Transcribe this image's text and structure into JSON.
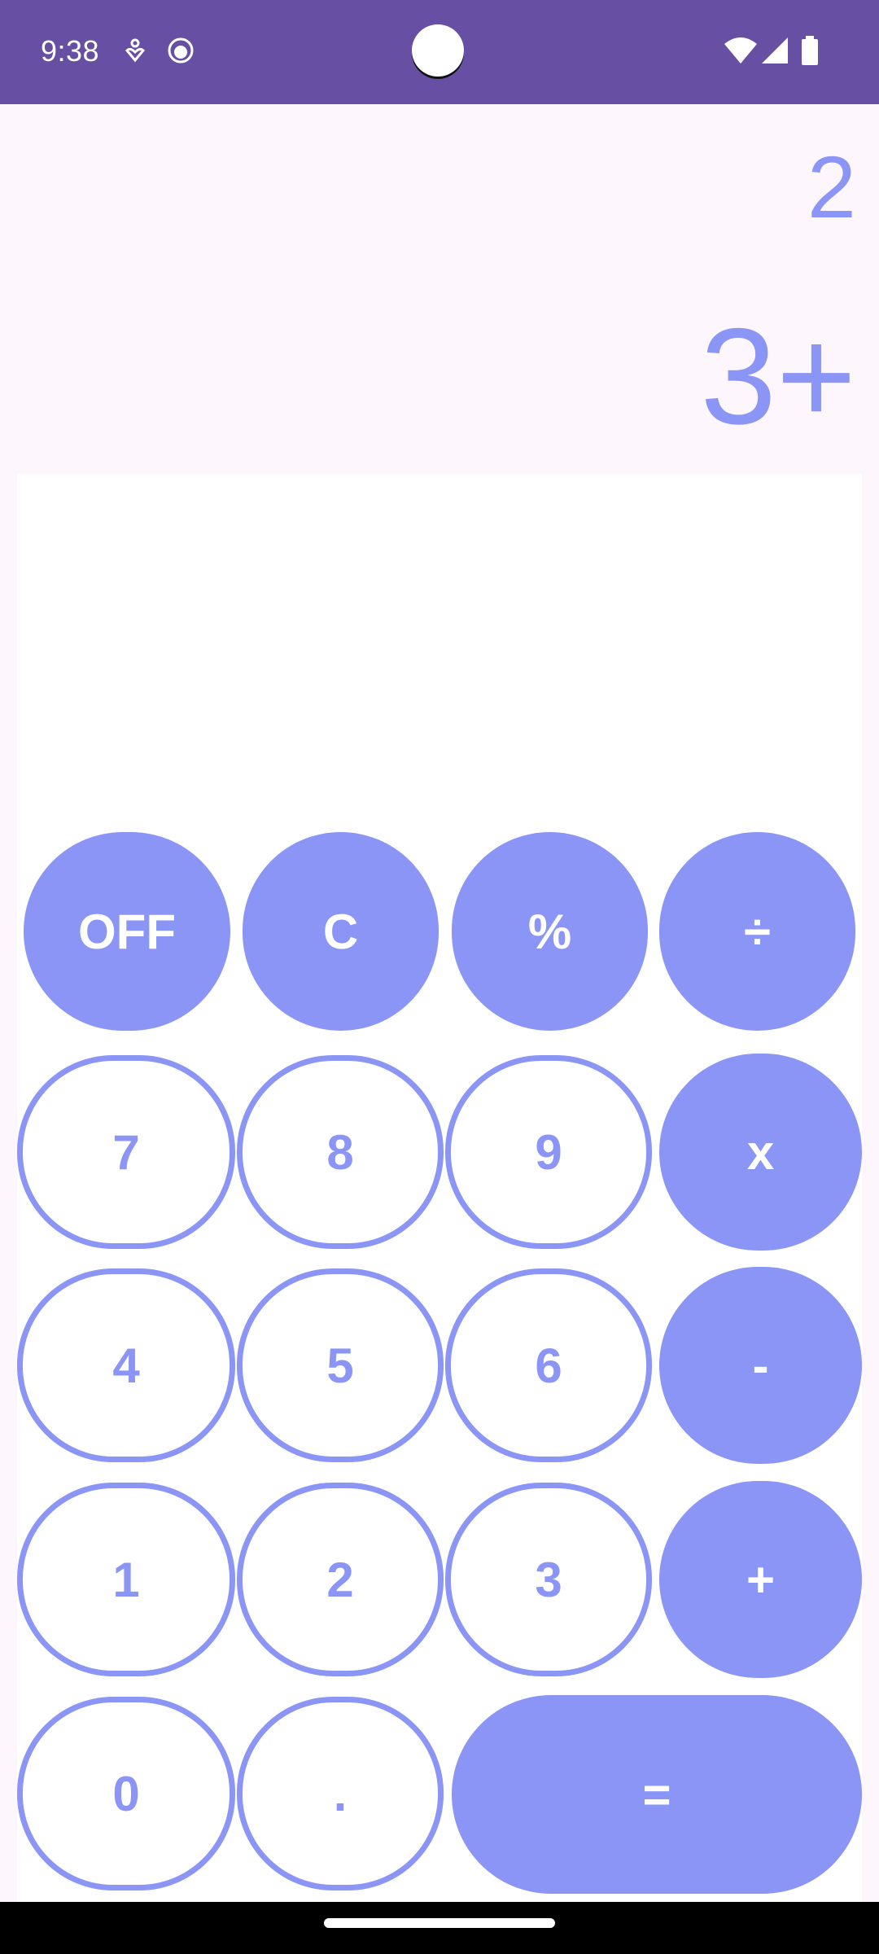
{
  "status_bar": {
    "time": "9:38",
    "icons": [
      "heart-person-icon",
      "cat-face-icon",
      "wifi-icon",
      "signal-icon",
      "battery-icon"
    ],
    "background": "#6750A4"
  },
  "display": {
    "result": "2",
    "expression": "3+"
  },
  "keypad": {
    "row1": [
      "OFF",
      "C",
      "%",
      "÷"
    ],
    "row2": [
      "7",
      "8",
      "9",
      "x"
    ],
    "row3": [
      "4",
      "5",
      "6",
      "-"
    ],
    "row4": [
      "1",
      "2",
      "3",
      "+"
    ],
    "row5": [
      "0",
      ".",
      "="
    ]
  },
  "colors": {
    "accent": "#8A95F6",
    "background": "#FDF7FD",
    "panel": "#FFFFFF"
  }
}
